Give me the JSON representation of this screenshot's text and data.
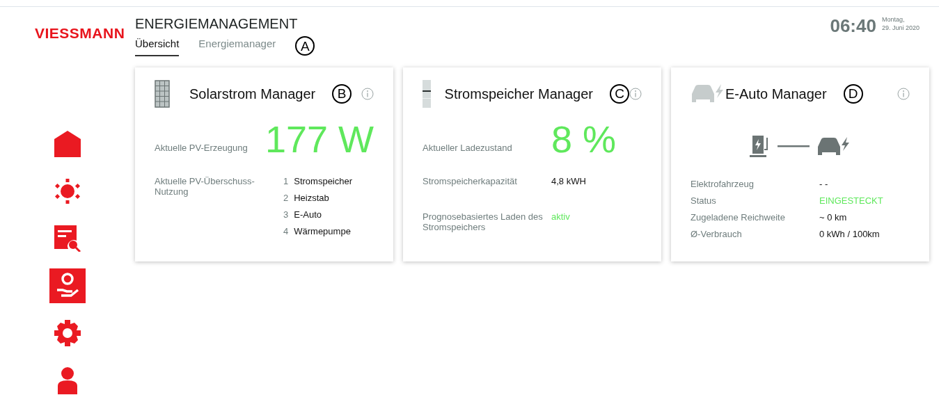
{
  "logo": "VIESSMANN",
  "sidebar": {
    "items": [
      {
        "kind": "home",
        "selected": false
      },
      {
        "kind": "sun",
        "selected": false
      },
      {
        "kind": "report",
        "selected": false
      },
      {
        "kind": "energy",
        "selected": true
      },
      {
        "kind": "settings",
        "selected": false
      },
      {
        "kind": "user",
        "selected": false
      }
    ]
  },
  "header": {
    "title": "ENERGIEMANAGEMENT",
    "tabs": [
      {
        "label": "Übersicht",
        "selected": true
      },
      {
        "label": "Energiemanager",
        "selected": false
      }
    ],
    "marker": "A",
    "time": "06:40",
    "weekday": "Montag,",
    "date": "29. Juni 2020"
  },
  "cards": [
    {
      "kind": "solar",
      "title": "Solarstrom Manager",
      "marker": "B",
      "headline": {
        "label": "Aktuelle PV-Erzeugung",
        "value": "177 W"
      },
      "rows": [
        {
          "label": "Aktuelle PV-Überschuss-Nutzung",
          "list": [
            {
              "index": "1",
              "text": "Stromspeicher"
            },
            {
              "index": "2",
              "text": "Heizstab"
            },
            {
              "index": "3",
              "text": "E-Auto"
            },
            {
              "index": "4",
              "text": "Wärmepumpe"
            }
          ]
        }
      ]
    },
    {
      "kind": "battery",
      "title": "Stromspeicher Manager",
      "marker": "C",
      "headline": {
        "label": "Aktueller Ladezustand",
        "value": "8 %"
      },
      "rows": [
        {
          "label": "Stromspeicherkapazität",
          "value": "4,8 kWH",
          "highlight": false
        },
        {
          "label": "Prognosebasiertes Laden des Stromspeichers",
          "value": "aktiv",
          "highlight": true
        }
      ]
    },
    {
      "kind": "car",
      "title": "E-Auto Manager",
      "marker": "D",
      "rows": [
        {
          "label": "Elektrofahrzeug",
          "value": "- -",
          "highlight": false
        },
        {
          "label": "Status",
          "value": "EINGESTECKT",
          "highlight": true
        },
        {
          "label": "Zugeladene Reichweite",
          "value": "~ 0 km",
          "highlight": false
        },
        {
          "label": "Ø-Verbrauch",
          "value": "0 kWh / 100km",
          "highlight": false
        }
      ]
    }
  ]
}
